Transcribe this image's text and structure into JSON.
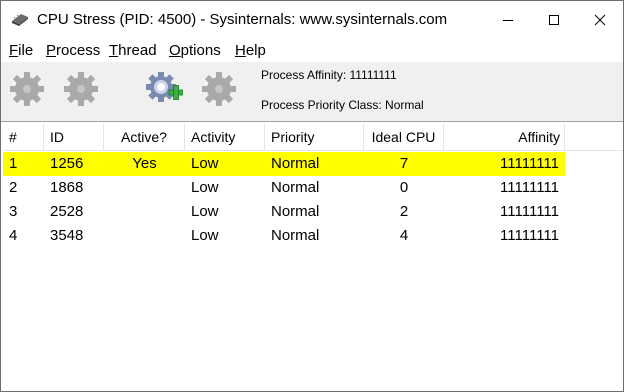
{
  "window": {
    "title": "CPU Stress (PID: 4500) - Sysinternals: www.sysinternals.com"
  },
  "menu": {
    "items": [
      {
        "label": "File",
        "key": "F",
        "rest": "ile"
      },
      {
        "label": "Process",
        "key": "P",
        "rest": "rocess"
      },
      {
        "label": "Thread",
        "key": "T",
        "rest": "hread"
      },
      {
        "label": "Options",
        "key": "O",
        "rest": "ptions"
      },
      {
        "label": "Help",
        "key": "H",
        "rest": "elp"
      }
    ]
  },
  "toolbar": {
    "buttons": [
      {
        "icon": "gear-icon",
        "enabled": false
      },
      {
        "icon": "gear-icon",
        "enabled": false
      },
      {
        "icon": "gear-add-icon",
        "enabled": true
      },
      {
        "icon": "gear-icon",
        "enabled": false
      }
    ],
    "process_affinity": "Process Affinity: 11111111",
    "process_priority": "Process Priority Class: Normal"
  },
  "table": {
    "columns": [
      "#",
      "ID",
      "Active?",
      "Activity",
      "Priority",
      "Ideal CPU",
      "Affinity"
    ],
    "rows": [
      {
        "num": "1",
        "id": "1256",
        "active": "Yes",
        "activity": "Low",
        "priority": "Normal",
        "ideal_cpu": "7",
        "affinity": "11111111",
        "selected": true
      },
      {
        "num": "2",
        "id": "1868",
        "active": "",
        "activity": "Low",
        "priority": "Normal",
        "ideal_cpu": "0",
        "affinity": "11111111",
        "selected": false
      },
      {
        "num": "3",
        "id": "2528",
        "active": "",
        "activity": "Low",
        "priority": "Normal",
        "ideal_cpu": "2",
        "affinity": "11111111",
        "selected": false
      },
      {
        "num": "4",
        "id": "3548",
        "active": "",
        "activity": "Low",
        "priority": "Normal",
        "ideal_cpu": "4",
        "affinity": "11111111",
        "selected": false
      }
    ]
  },
  "colors": {
    "selection": "#ffff00",
    "toolbar_bg": "#f0f0f0",
    "disabled_gear": "#a9a9a9",
    "add_badge": "#3cb043"
  }
}
